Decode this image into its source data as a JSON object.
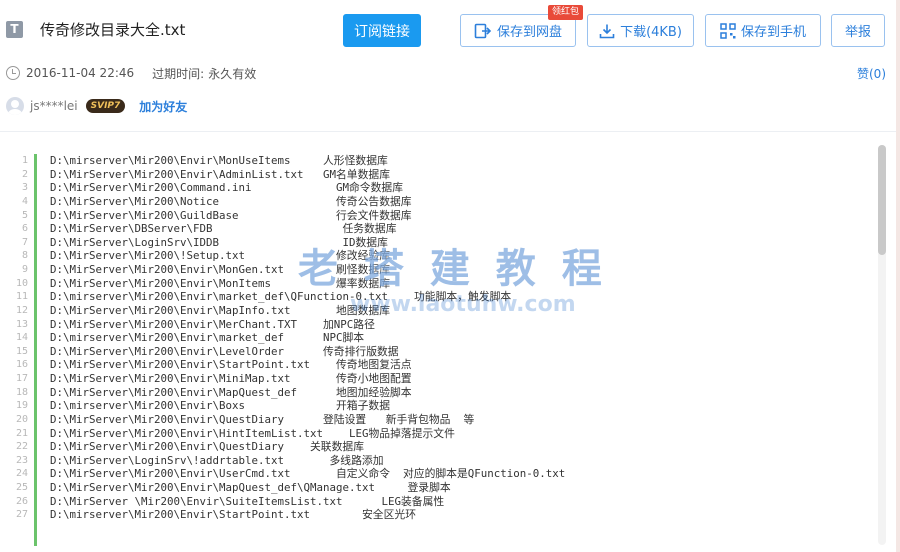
{
  "file": {
    "title": "传奇修改目录大全.txt",
    "type_icon": "T"
  },
  "actions": {
    "subscribe": "订阅链接",
    "save_to_cloud": "保存到网盘",
    "red_packet_badge": "领红包",
    "download": "下载(4KB)",
    "save_to_phone": "保存到手机",
    "report": "举报"
  },
  "meta": {
    "date": "2016-11-04 22:46",
    "expire_label": "过期时间:",
    "expire_value": "永久有效",
    "like": "赞(0)"
  },
  "user": {
    "name": "js****lei",
    "vip_badge": "SVIP7",
    "add_friend": "加为好友"
  },
  "watermark": {
    "main": "老 塔 建 教 程",
    "sub": "www.laotuhw.com"
  },
  "colors": {
    "accent": "#1a9af0",
    "link": "#2c7fdb",
    "badge": "#e94a39",
    "gutter_bar": "#6bc36b"
  },
  "lines": [
    "D:\\mirserver\\Mir200\\Envir\\MonUseItems     人形怪数据库",
    "D:\\MirServer\\Mir200\\Envir\\AdminList.txt   GM名单数据库",
    "D:\\MirServer\\Mir200\\Command.ini             GM命令数据库",
    "D:\\MirServer\\Mir200\\Notice                  传奇公告数据库",
    "D:\\MirServer\\Mir200\\GuildBase               行会文件数据库",
    "D:\\MirServer\\DBServer\\FDB                    任务数据库",
    "D:\\MirServer\\LoginSrv\\IDDB                   ID数据库",
    "D:\\MirServer\\Mir200\\!Setup.txt              修改经验库",
    "D:\\MirServer\\Mir200\\Envir\\MonGen.txt        刷怪数据库",
    "D:\\MirServer\\Mir200\\Envir\\MonItems          爆率数据库",
    "D:\\mirserver\\Mir200\\Envir\\market_def\\QFunction-0.txt    功能脚本，触发脚本",
    "D:\\MirServer\\Mir200\\Envir\\MapInfo.txt       地图数据库",
    "D:\\MirServer\\Mir200\\Envir\\MerChant.TXT    加NPC路径",
    "D:\\mirserver\\Mir200\\Envir\\market_def      NPC脚本",
    "D:\\MirServer\\Mir200\\Envir\\LevelOrder      传奇排行版数据",
    "D:\\MirServer\\Mir200\\Envir\\StartPoint.txt    传奇地图复活点",
    "D:\\MirServer\\Mir200\\Envir\\MiniMap.txt       传奇小地图配置",
    "D:\\MirServer\\Mir200\\Envir\\MapQuest_def      地图加经验脚本",
    "D:\\mirserver\\Mir200\\Envir\\Boxs              开箱子数据",
    "D:\\MirServer\\Mir200\\Envir\\QuestDiary      登陆设置   新手背包物品  等",
    "D:\\MirServer\\Mir200\\Envir\\HintItemList.txt    LEG物品掉落提示文件",
    "D:\\MirServer\\Mir200\\Envir\\QuestDiary    关联数据库",
    "D:\\MirServer\\LoginSrv\\!addrtable.txt       多线路添加",
    "D:\\MirServer\\Mir200\\Envir\\UserCmd.txt       自定义命令  对应的脚本是QFunction-0.txt",
    "D:\\MirServer\\Mir200\\Envir\\MapQuest_def\\QManage.txt     登录脚本",
    "D:\\MirServer \\Mir200\\Envir\\SuiteItemsList.txt      LEG装备属性",
    "D:\\mirserver\\Mir200\\Envir\\StartPoint.txt        安全区光环"
  ]
}
